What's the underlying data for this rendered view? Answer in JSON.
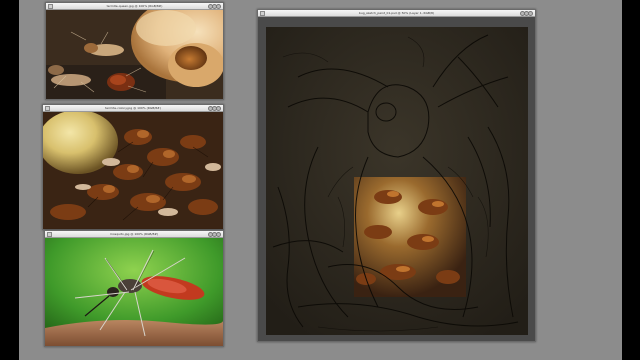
{
  "windows": [
    {
      "id": "termite-queen",
      "title": "termite-queen.jpg @ 100% (RGB/8#)",
      "subject": "termite queen and workers"
    },
    {
      "id": "termite-colony",
      "title": "termite-colony.jpg @ 100% (RGB/8#)",
      "subject": "termite colony"
    },
    {
      "id": "mosquito",
      "title": "mosquito.jpg @ 100% (RGB/8#)",
      "subject": "mosquito feeding on skin"
    },
    {
      "id": "bug-sketch",
      "title": "bug_sketch_paint_01.psd @ 50% (Layer 1, RGB/8)",
      "subject": "creature sketch with pasted termite photo"
    }
  ],
  "colors": {
    "workspace": "#8c8c8c",
    "titlebar": "#e6e6e6",
    "canvas_dark": "#2e2a22",
    "sketch_line": "#0b0905",
    "termite_body": "#8a4a18",
    "queen_abdomen": "#e8c79a",
    "leaf_green": "#3f9a2a",
    "mosquito_red": "#c23a1f",
    "skin": "#a2704e"
  },
  "icons": [
    "close-button-icon",
    "minimize-button-icon",
    "zoom-button-icon",
    "document-icon"
  ]
}
